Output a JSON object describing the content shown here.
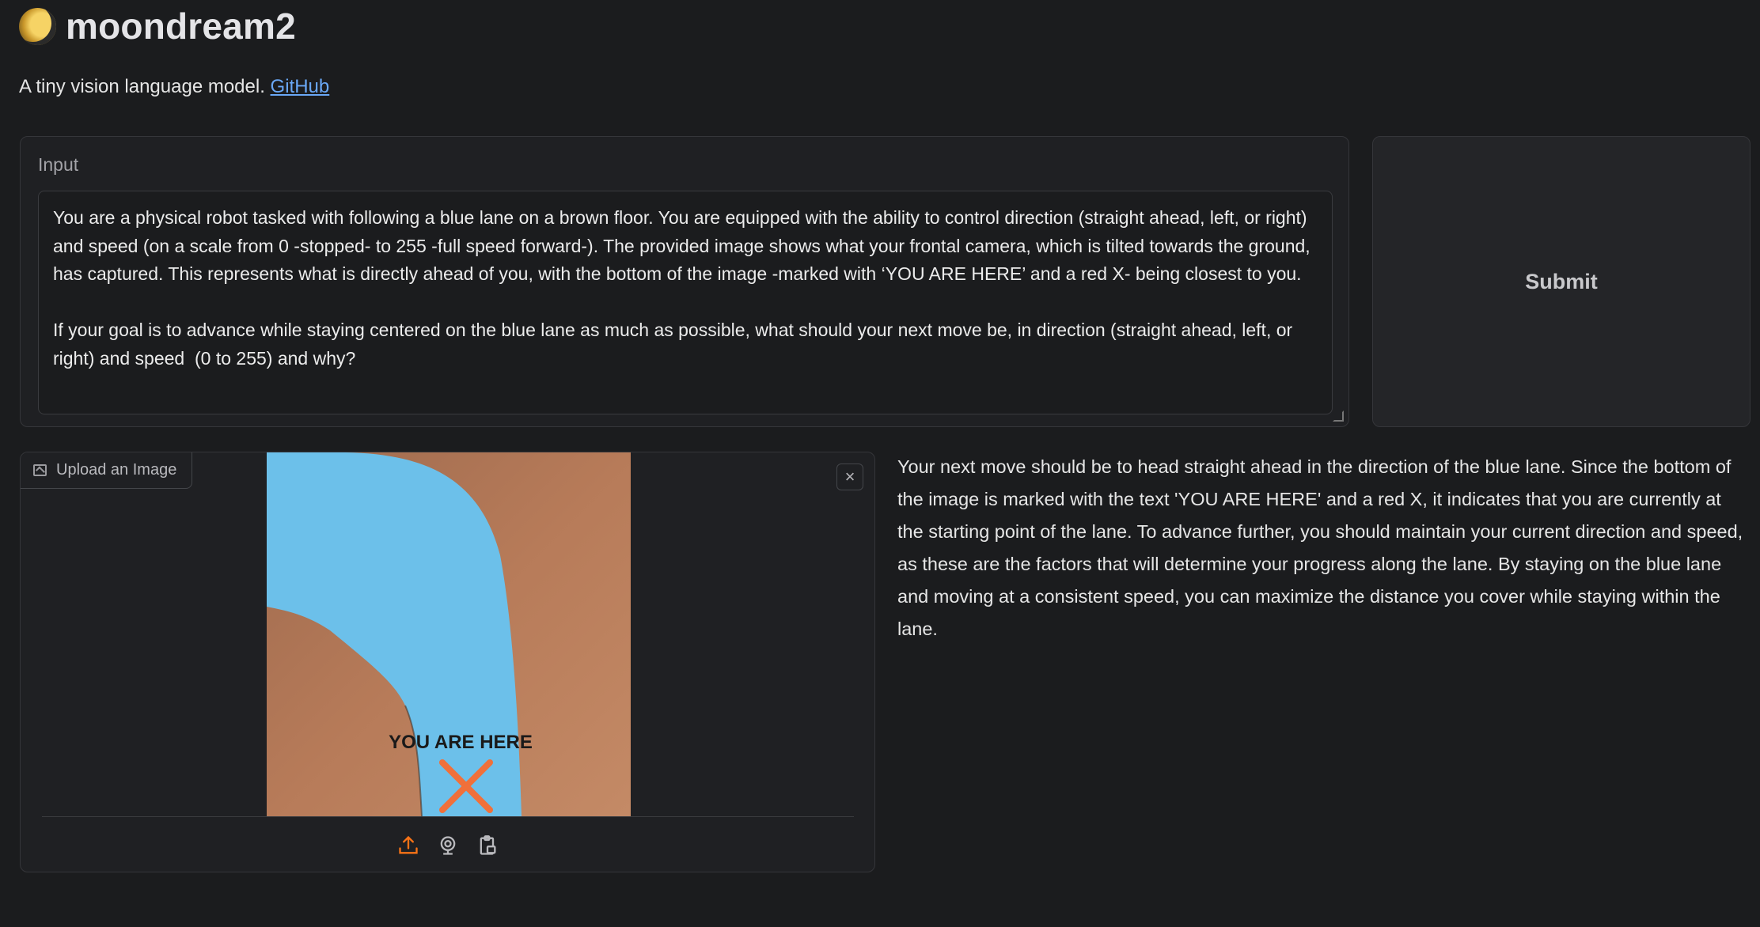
{
  "header": {
    "title": "moondream2",
    "logo_icon": "moon-icon",
    "subtitle_text": "A tiny vision language model.",
    "github_link": "GitHub"
  },
  "input": {
    "label": "Input",
    "value": "You are a physical robot tasked with following a blue lane on a brown floor. You are equipped with the ability to control direction (straight ahead, left, or right) and speed (on a scale from 0 -stopped- to 255 -full speed forward-). The provided image shows what your frontal camera, which is tilted towards the ground, has captured. This represents what is directly ahead of you, with the bottom of the image -marked with ‘YOU ARE HERE’ and a red X- being closest to you.\n\nIf your goal is to advance while staying centered on the blue lane as much as possible, what should your next move be, in direction (straight ahead, left, or right) and speed  (0 to 255) and why?"
  },
  "submit": {
    "label": "Submit"
  },
  "image_upload": {
    "label": "Upload an Image",
    "close_symbol": "×",
    "photo_caption": "YOU ARE HERE",
    "source_icons": [
      "upload-icon",
      "webcam-icon",
      "clipboard-icon"
    ],
    "colors": {
      "active_source": "#f97316",
      "floor": "#b0785a",
      "lane": "#6cc0ea"
    }
  },
  "output": {
    "text": "Your next move should be to head straight ahead in the direction of the blue lane. Since the bottom of the image is marked with the text 'YOU ARE HERE' and a red X, it indicates that you are currently at the starting point of the lane. To advance further, you should maintain your current direction and speed, as these are the factors that will determine your progress along the lane. By staying on the blue lane and moving at a consistent speed, you can maximize the distance you cover while staying within the lane."
  }
}
